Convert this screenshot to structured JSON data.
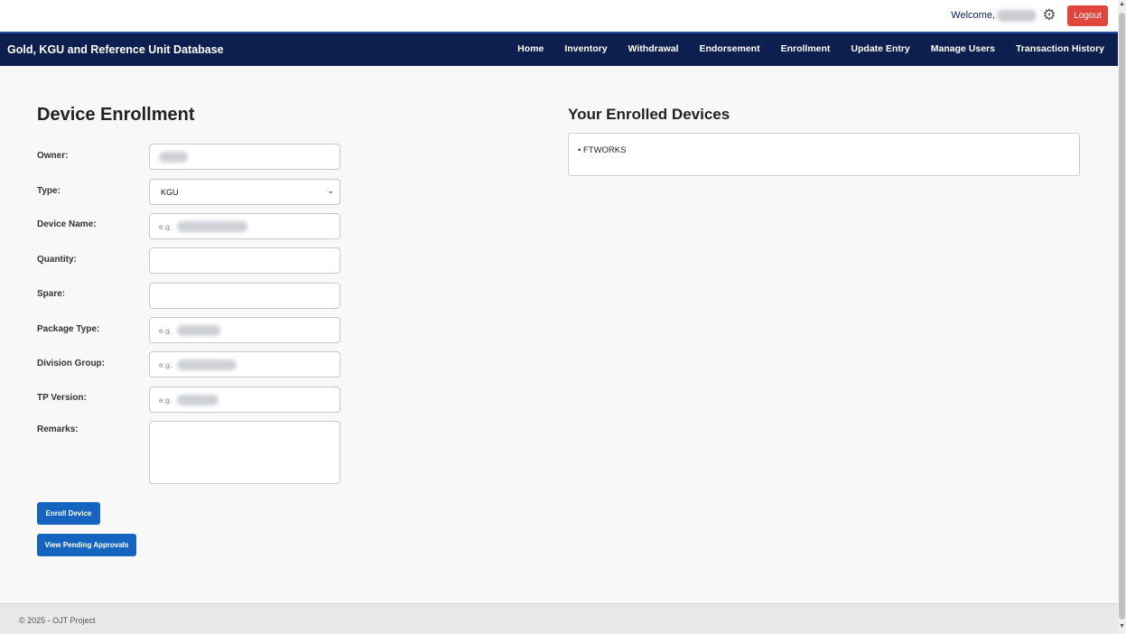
{
  "header": {
    "welcome_text": "Welcome,",
    "logout_label": "Logout",
    "settings_icon": "gear-icon"
  },
  "nav": {
    "brand": "Gold, KGU and Reference Unit Database",
    "items": [
      "Home",
      "Inventory",
      "Withdrawal",
      "Endorsement",
      "Enrollment",
      "Update Entry",
      "Manage Users",
      "Transaction History"
    ]
  },
  "form": {
    "title": "Device Enrollment",
    "owner_label": "Owner:",
    "type_label": "Type:",
    "type_value": "KGU",
    "device_name_label": "Device Name:",
    "device_name_placeholder": "e.g.",
    "quantity_label": "Quantity:",
    "spare_label": "Spare:",
    "package_type_label": "Package Type:",
    "package_type_placeholder": "e.g.",
    "division_group_label": "Division Group:",
    "division_group_placeholder": "e.g.",
    "tp_version_label": "TP Version:",
    "tp_version_placeholder": "e.g.",
    "remarks_label": "Remarks:",
    "enroll_button": "Enroll Device",
    "pending_button": "View Pending Approvals"
  },
  "enrolled": {
    "title": "Your Enrolled Devices",
    "items": [
      "• FTWORKS"
    ]
  },
  "footer": {
    "text": "© 2025 - OJT Project"
  }
}
